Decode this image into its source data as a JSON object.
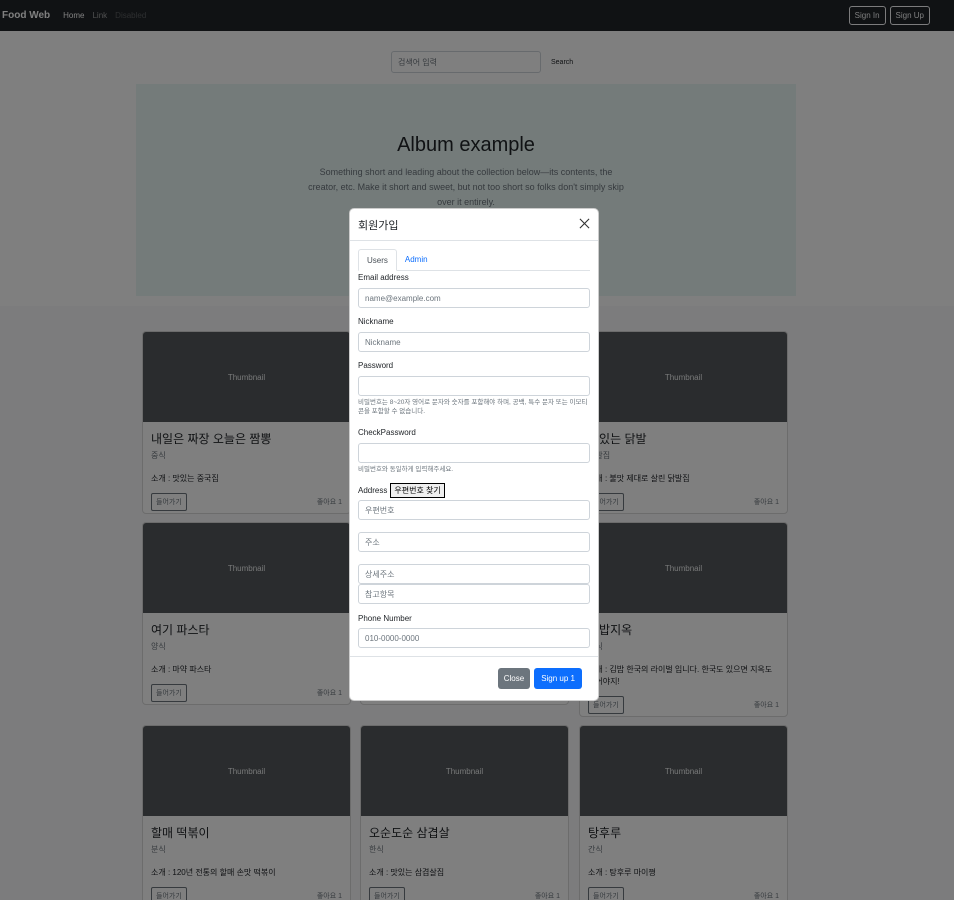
{
  "navbar": {
    "brand": "Food Web",
    "links": {
      "home": "Home",
      "link": "Link",
      "disabled": "Disabled"
    },
    "sign_in": "Sign In",
    "sign_up": "Sign Up"
  },
  "search": {
    "placeholder": "검색어 입력",
    "button": "Search"
  },
  "hero": {
    "title": "Album example",
    "text": "Something short and leading about the collection below—its contents, the creator, etc. Make it short and sweet, but not too short so folks don't simply skip over it entirely."
  },
  "cards": [
    {
      "thumb": "Thumbnail",
      "title": "내일은 짜장 오늘은 짬뽕",
      "category": "중식",
      "desc": "소개 : 맛있는 중국집",
      "button": "들어가기",
      "likes": "좋아요 1"
    },
    {
      "thumb": "Thumbnail",
      "title": "맛있는 닭발",
      "category": "닭발집",
      "desc": "소개 : 불맛 제대로 살린 닭발집",
      "button": "들어가기",
      "likes": "좋아요 1"
    },
    {
      "thumb": "Thumbnail",
      "title": "여기 파스타",
      "category": "양식",
      "desc": "소개 : 마약 파스타",
      "button": "들어가기",
      "likes": "좋아요 1"
    },
    {
      "thumb": "Thumbnail",
      "title": "김밥지옥",
      "category": "분식",
      "desc": "소개 : 김밥 한국의 라이벌 입니다. 한국도 있으면 지옥도 있어야지!",
      "button": "들어가기",
      "likes": "좋아요 1"
    },
    {
      "thumb": "Thumbnail",
      "title": "할매 떡볶이",
      "category": "분식",
      "desc": "소개 : 120년 전통의 할매 손맛 떡볶이",
      "button": "들어가기",
      "likes": "좋아요 1"
    },
    {
      "thumb": "Thumbnail",
      "title": "오순도순 삼겹살",
      "category": "한식",
      "desc": "소개 : 맛있는 삼겹살집",
      "button": "들어가기",
      "likes": "좋아요 1"
    },
    {
      "thumb": "Thumbnail",
      "title": "탕후루",
      "category": "간식",
      "desc": "소개 : 탕후루 마이쪙",
      "button": "들어가기",
      "likes": "좋아요 1"
    }
  ],
  "modal": {
    "title": "회원가입",
    "tabs": {
      "users": "Users",
      "admin": "Admin"
    },
    "email_label": "Email address",
    "email_placeholder": "name@example.com",
    "nickname_label": "Nickname",
    "nickname_placeholder": "Nickname",
    "password_label": "Password",
    "password_help": "비밀번호는 8~20자 영어로 문자와 숫자를 포함해야 하며, 공백, 특수 문자 또는 이모티콘을 포함할 수 없습니다.",
    "check_label": "CheckPassword",
    "check_help": "비밀번호와 동일하게 입력해주세요.",
    "address_label": "Address",
    "postcode_button": "우편번호 찾기",
    "postcode_placeholder": "우편번호",
    "address_placeholder": "주소",
    "detail_placeholder": "상세주소",
    "extra_placeholder": "참고항목",
    "phone_label": "Phone Number",
    "phone_placeholder": "010-0000-0000",
    "close_button": "Close",
    "submit_button": "Sign up 1"
  }
}
